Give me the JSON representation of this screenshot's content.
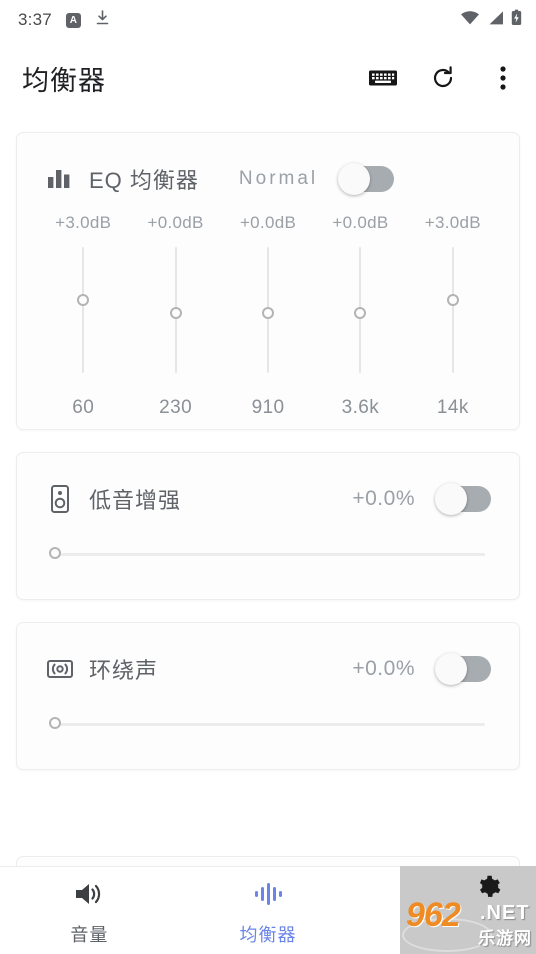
{
  "status_bar": {
    "time": "3:37",
    "badge_letter": "A",
    "icons": [
      "download-icon",
      "wifi-icon",
      "signal-icon",
      "battery-charging-icon"
    ]
  },
  "app_bar": {
    "title": "均衡器",
    "actions": [
      {
        "name": "keyboard-icon"
      },
      {
        "name": "refresh-icon"
      },
      {
        "name": "overflow-menu-icon"
      }
    ]
  },
  "cards": {
    "equalizer": {
      "icon": "bar-chart-icon",
      "title": "EQ 均衡器",
      "preset": "Normal",
      "enabled": false,
      "bands": [
        {
          "db": "+3.0dB",
          "hz": "60",
          "pos": 0.39
        },
        {
          "db": "+0.0dB",
          "hz": "230",
          "pos": 0.5
        },
        {
          "db": "+0.0dB",
          "hz": "910",
          "pos": 0.5
        },
        {
          "db": "+0.0dB",
          "hz": "3.6k",
          "pos": 0.5
        },
        {
          "db": "+3.0dB",
          "hz": "14k",
          "pos": 0.39
        }
      ]
    },
    "bass_boost": {
      "icon": "speaker-icon",
      "title": "低音增强",
      "value": "+0.0%",
      "enabled": false,
      "slider_pos": 0
    },
    "surround": {
      "icon": "surround-icon",
      "title": "环绕声",
      "value": "+0.0%",
      "enabled": false,
      "slider_pos": 0
    }
  },
  "bottom_nav": {
    "items": [
      {
        "label": "音量",
        "icon": "volume-icon",
        "active": false
      },
      {
        "label": "均衡器",
        "icon": "equalizer-waveform-icon",
        "active": true
      }
    ],
    "settings_tab": {
      "icon": "gear-icon"
    }
  },
  "watermark": {
    "number": "962",
    "domain": ".NET",
    "chinese": "乐游网"
  },
  "colors": {
    "accent": "#6b84e8",
    "text_primary": "#202124",
    "text_secondary": "#5f6368",
    "text_muted": "#9aa0a6",
    "track": "#e6e6e6",
    "switch_off": "#a7acb1",
    "watermark_orange": "#f08a23"
  }
}
